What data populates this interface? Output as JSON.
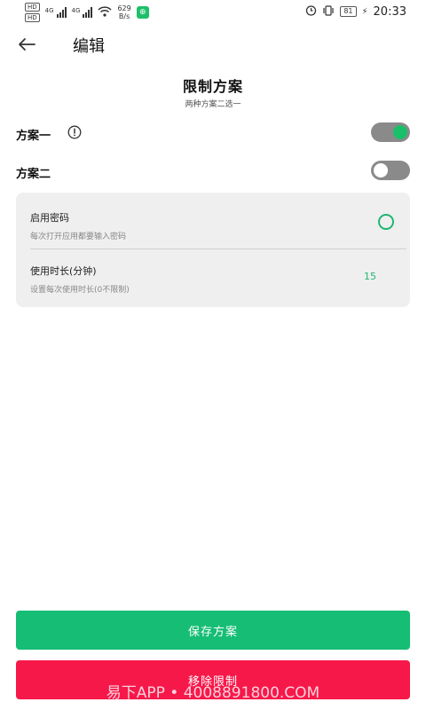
{
  "status_bar": {
    "hd_badge": "HD",
    "sim1_label": "4G",
    "sim2_label": "4G",
    "speed_value": "629",
    "speed_unit": "B/s",
    "battery": "81",
    "time": "20:33",
    "icons": [
      "wifi-icon",
      "alarm-icon",
      "vibrate-icon",
      "battery-icon",
      "charging-icon"
    ]
  },
  "header": {
    "title": "编辑",
    "back_icon": "arrow-left-icon"
  },
  "plan": {
    "title": "限制方案",
    "subtitle": "两种方案二选一",
    "option1": {
      "label": "方案一",
      "enabled": true,
      "info_icon": "info-circle-icon"
    },
    "option2": {
      "label": "方案二",
      "enabled": false
    }
  },
  "settings": {
    "password": {
      "title": "启用密码",
      "description": "每次打开应用都要输入密码"
    },
    "duration": {
      "title": "使用时长(分钟)",
      "description": "设置每次使用时长(0不限制)",
      "value": "15"
    }
  },
  "actions": {
    "save_label": "保存方案",
    "remove_label": "移除限制"
  },
  "watermark": "易下APP • 4008891800.COM",
  "colors": {
    "accent_green": "#16bd75",
    "danger_red": "#f7184a",
    "card_bg": "#efefef"
  }
}
